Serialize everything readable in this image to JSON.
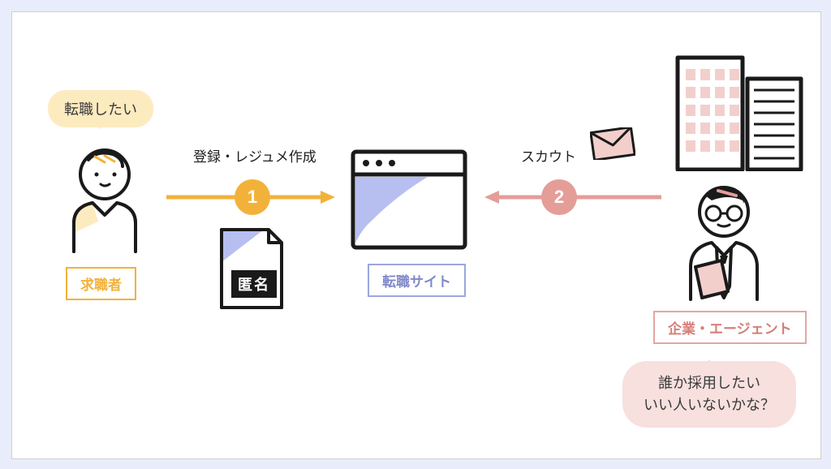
{
  "jobseeker": {
    "speech": "転職したい",
    "label": "求職者"
  },
  "step1": {
    "label": "登録・レジュメ作成",
    "badge": "1",
    "anonymous": "匿名"
  },
  "site": {
    "label": "転職サイト"
  },
  "step2": {
    "label": "スカウト",
    "badge": "2"
  },
  "company": {
    "label": "企業・エージェント",
    "speech_line1": "誰か採用したい",
    "speech_line2": "いい人いないかな？"
  },
  "colors": {
    "yellow": "#f2b23a",
    "blue": "#9ba6dd",
    "pink": "#e59d98"
  }
}
